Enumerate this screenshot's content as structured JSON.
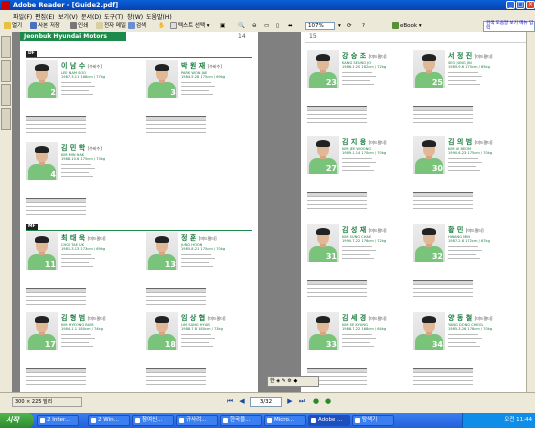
{
  "window": {
    "title": "Adobe Reader - [Guide2.pdf]"
  },
  "menu": [
    "파일(F)",
    "편집(E)",
    "보기(V)",
    "문서(D)",
    "도구(T)",
    "창(W)",
    "도움말(H)"
  ],
  "toolbar": {
    "items": [
      "열기",
      "사본 저장",
      "인쇄",
      "전자 메일",
      "검색"
    ],
    "select_tool": "텍스트 선택",
    "zoom": "107%",
    "ebook": "eBook",
    "help_text": "검색 도움말 보기 메뉴 입력"
  },
  "left_page": {
    "header": "Jeonbuk Hyundai Motors",
    "page_number": "14",
    "sections": [
      {
        "tag": "DF"
      },
      {
        "tag": "MF"
      }
    ],
    "players": [
      {
        "name": "이 남 수",
        "pos": "[수비수]",
        "roman": "LEE NAM SOO",
        "info": "1987.3.11  188cm / 77kg",
        "number": "2"
      },
      {
        "name": "박 원 재",
        "pos": "[수비수]",
        "roman": "PARK WON JAE",
        "info": "1984.5.28  175cm / 69kg",
        "number": "3"
      },
      {
        "name": "김 민 학",
        "pos": "[수비수]",
        "roman": "KIM MIN HAK",
        "info": "1988.10.6  175cm / 73kg",
        "number": "4"
      },
      {
        "name": "최 태 욱",
        "pos": "[미드필더]",
        "roman": "CHOI TAE UK",
        "info": "1981.3.13  173cm / 69kg",
        "number": "11"
      },
      {
        "name": "정 훈",
        "pos": "[미드필더]",
        "roman": "JUNG HOON",
        "info": "1985.8.21  175cm / 70kg",
        "number": "13"
      },
      {
        "name": "김 형 범",
        "pos": "[미드필더]",
        "roman": "KIM HYEONG BUM",
        "info": "1984.1.1  180cm / 74kg",
        "number": "17"
      },
      {
        "name": "임 상 협",
        "pos": "[미드필더]",
        "roman": "LIM SANG HYUB",
        "info": "1988.7.8  180cm / 73kg",
        "number": "18"
      }
    ]
  },
  "right_page": {
    "page_number": "15",
    "players": [
      {
        "name": "강 승 조",
        "pos": "[미드필더]",
        "roman": "KANG SEUNG JO",
        "info": "1986.1.20  182cm / 72kg",
        "number": "23"
      },
      {
        "name": "서 정 진",
        "pos": "[미드필더]",
        "roman": "SEO JUNG JIN",
        "info": "1989.9.6  175cm / 65kg",
        "number": "25"
      },
      {
        "name": "김 지 웅",
        "pos": "[미드필더]",
        "roman": "KIM JEE WOONG",
        "info": "1989.1.14  170cm / 70kg",
        "number": "27"
      },
      {
        "name": "김 의 범",
        "pos": "[미드필더]",
        "roman": "KIM UI BEOM",
        "info": "1990.6.23  175cm / 70kg",
        "number": "30"
      },
      {
        "name": "김 성 재",
        "pos": "[미드필더]",
        "roman": "KIM SUNG CHAE",
        "info": "1990.7.22  176cm / 72kg",
        "number": "31"
      },
      {
        "name": "황 민",
        "pos": "[미드필더]",
        "roman": "HWANG MIN",
        "info": "1987.2.8  172cm / 67kg",
        "number": "32"
      },
      {
        "name": "김 세 경",
        "pos": "[미드필더]",
        "roman": "KIM SE KYUNG",
        "info": "1988.7.22  168cm / 64kg",
        "number": "33"
      },
      {
        "name": "양 동 철",
        "pos": "[미드필더]",
        "roman": "YANG DONG CHEOL",
        "info": "1985.3.26  178cm / 70kg",
        "number": "34"
      }
    ]
  },
  "status": {
    "page_size": "300 × 225 밀리",
    "page_indicator": "3/32",
    "float_toolbar": "한"
  },
  "taskbar": {
    "start": "시작",
    "tasks": [
      "2 Inter...",
      "2 Win...",
      "참여신...",
      "규사려...",
      "한국을...",
      "Micro...",
      "Adobe ...",
      "탐색기"
    ],
    "clock": "오전 11:44"
  }
}
